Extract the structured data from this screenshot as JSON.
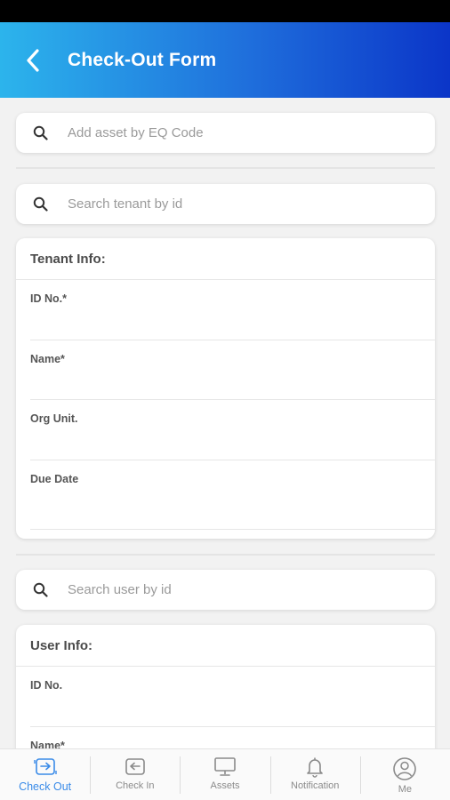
{
  "header": {
    "title": "Check-Out Form",
    "back_icon": "chevron-left-icon"
  },
  "asset_search": {
    "placeholder": "Add asset by EQ Code"
  },
  "tenant_search": {
    "placeholder": "Search tenant by id"
  },
  "tenant_info": {
    "title": "Tenant Info:",
    "fields": [
      "ID No.*",
      "Name*",
      "Org Unit.",
      "Due Date"
    ]
  },
  "user_search": {
    "placeholder": "Search user by id"
  },
  "user_info": {
    "title": "User Info:",
    "fields": [
      "ID No.",
      "Name*"
    ]
  },
  "bottom_nav": {
    "items": [
      {
        "label": "Check Out",
        "icon": "check-out-icon",
        "active": true
      },
      {
        "label": "Check In",
        "icon": "check-in-icon",
        "active": false
      },
      {
        "label": "Assets",
        "icon": "monitor-icon",
        "active": false
      },
      {
        "label": "Notification",
        "icon": "bell-icon",
        "active": false
      },
      {
        "label": "Me",
        "icon": "user-icon",
        "active": false
      }
    ]
  },
  "colors": {
    "header_gradient_start": "#2cb4ec",
    "header_gradient_end": "#0b35c8",
    "active_nav": "#3a8be8"
  }
}
